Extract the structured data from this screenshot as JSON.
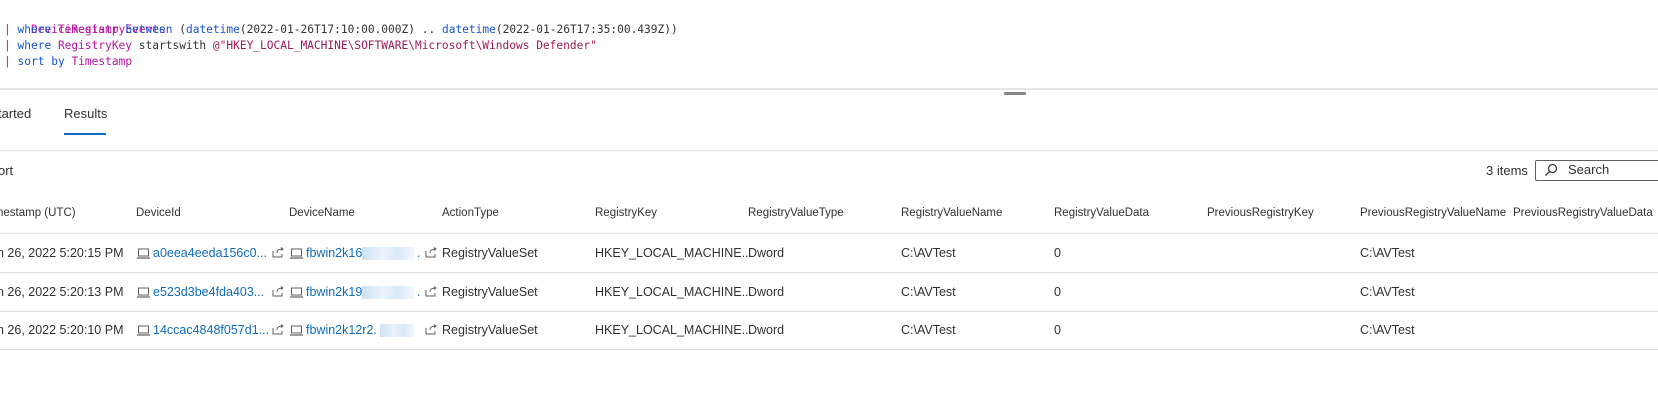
{
  "query": {
    "line1": {
      "table": "DeviceRegistryEvents"
    },
    "line2": {
      "pipe": "|",
      "where": "where",
      "field": "Timestamp",
      "op": "between",
      "open": "(",
      "fn1": "datetime",
      "arg1": "(2022-01-26T17:10:00.000Z)",
      "range": "..",
      "fn2": "datetime",
      "arg2": "(2022-01-26T17:35:00.439Z))"
    },
    "line3": {
      "pipe": "|",
      "where": "where",
      "field": "RegistryKey",
      "op": "startswith",
      "str": "@\"HKEY_LOCAL_MACHINE\\SOFTWARE\\Microsoft\\Windows Defender\""
    },
    "line4": {
      "pipe": "|",
      "sort": "sort",
      "by": "by",
      "field": "Timestamp"
    }
  },
  "tabs": [
    {
      "label": "tarted"
    },
    {
      "label": "Results"
    }
  ],
  "toolbar": {
    "export_label": "ort",
    "items_count": "3 items",
    "search_placeholder": "Search"
  },
  "table": {
    "columns": [
      "nestamp (UTC)",
      "DeviceId",
      "DeviceName",
      "ActionType",
      "RegistryKey",
      "RegistryValueType",
      "RegistryValueName",
      "RegistryValueData",
      "PreviousRegistryKey",
      "PreviousRegistryValueName",
      "PreviousRegistryValueData"
    ],
    "rows": [
      {
        "timestamp": "n 26, 2022 5:20:15 PM",
        "device_id": "a0eea4eeda156c0...",
        "device_name": "fbwin2k16.",
        "device_name_tail": ".",
        "action_type": "RegistryValueSet",
        "registry_key": "HKEY_LOCAL_MACHINE...",
        "value_type": "Dword",
        "value_name": "C:\\AVTest",
        "value_data": "0",
        "prev_key": "",
        "prev_value_name": "C:\\AVTest",
        "prev_value_data": ""
      },
      {
        "timestamp": "n 26, 2022 5:20:13 PM",
        "device_id": "e523d3be4fda403...",
        "device_name": "fbwin2k19.",
        "device_name_tail": ".",
        "action_type": "RegistryValueSet",
        "registry_key": "HKEY_LOCAL_MACHINE...",
        "value_type": "Dword",
        "value_name": "C:\\AVTest",
        "value_data": "0",
        "prev_key": "",
        "prev_value_name": "C:\\AVTest",
        "prev_value_data": ""
      },
      {
        "timestamp": "n 26, 2022 5:20:10 PM",
        "device_id": "14ccac4848f057d1...",
        "device_name": "fbwin2k12r2.",
        "device_name_tail": "",
        "action_type": "RegistryValueSet",
        "registry_key": "HKEY_LOCAL_MACHINE...",
        "value_type": "Dword",
        "value_name": "C:\\AVTest",
        "value_data": "0",
        "prev_key": "",
        "prev_value_name": "C:\\AVTest",
        "prev_value_data": ""
      }
    ]
  },
  "colors": {
    "link": "#0f6cbd",
    "keyword_pink": "#b5179e",
    "keyword_blue": "#1a55d6",
    "tab_underline": "#0f6cbd"
  },
  "icons": [
    "computer-icon",
    "share-icon",
    "search-icon"
  ]
}
